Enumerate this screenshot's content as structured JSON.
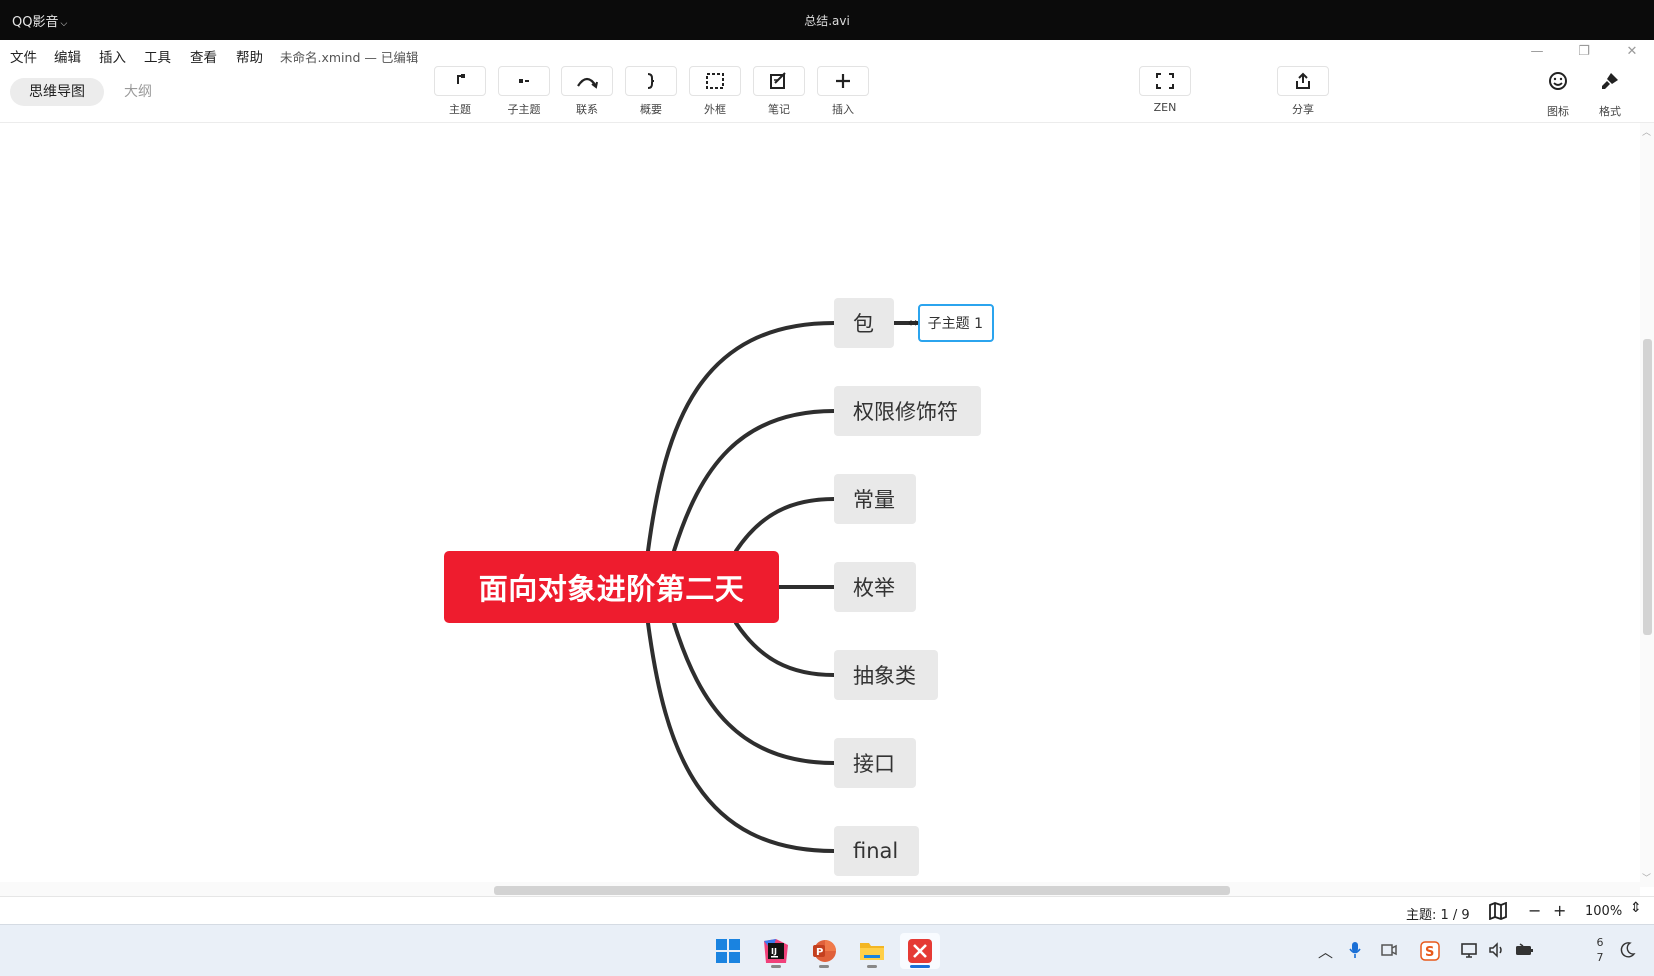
{
  "player": {
    "brand": "QQ影音",
    "file_title": "总结.avi"
  },
  "menu": [
    "文件",
    "编辑",
    "插入",
    "工具",
    "查看",
    "帮助"
  ],
  "document": {
    "name": "未命名.xmind",
    "state": "— 已编辑"
  },
  "view_tabs": {
    "mindmap": "思维导图",
    "outline": "大纲"
  },
  "toolbar": [
    {
      "label": "主题",
      "icon": "topic-icon"
    },
    {
      "label": "子主题",
      "icon": "subtopic-icon"
    },
    {
      "label": "联系",
      "icon": "relationship-icon"
    },
    {
      "label": "概要",
      "icon": "summary-brace-icon"
    },
    {
      "label": "外框",
      "icon": "boundary-icon"
    },
    {
      "label": "笔记",
      "icon": "note-icon"
    },
    {
      "label": "插入",
      "icon": "plus-icon"
    },
    {
      "label": "ZEN",
      "icon": "fullscreen-icon"
    },
    {
      "label": "分享",
      "icon": "share-icon"
    },
    {
      "label": "图标",
      "icon": "smiley-icon"
    },
    {
      "label": "格式",
      "icon": "format-brush-icon"
    }
  ],
  "mindmap": {
    "central": "面向对象进阶第二天",
    "branches": [
      "包",
      "权限修饰符",
      "常量",
      "枚举",
      "抽象类",
      "接口",
      "final"
    ],
    "editing_subtopic": "子主题 1"
  },
  "status": {
    "topic_count": "主题: 1 / 9",
    "zoom": "100%"
  },
  "taskbar": {
    "apps": [
      "windows-start-icon",
      "intellij-idea-icon",
      "powerpoint-icon",
      "file-explorer-icon",
      "xmind-icon"
    ],
    "clock": [
      "6",
      "7"
    ]
  },
  "colors": {
    "central_topic": "#ee1c2e",
    "branch_node": "#e9e9e9",
    "selection": "#2ba4ee"
  }
}
